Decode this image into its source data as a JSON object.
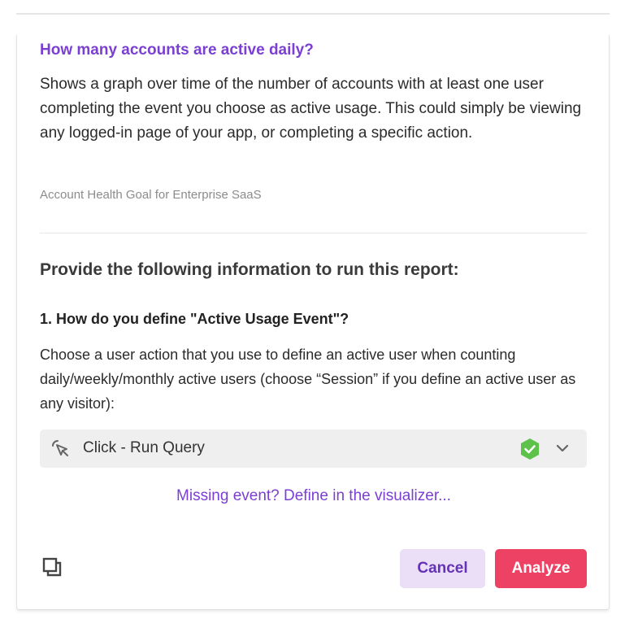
{
  "report": {
    "title": "How many accounts are active daily?",
    "description": "Shows a graph over time of the number of accounts with at least one user completing the event you choose as active usage. This could simply be viewing any logged-in page of your app, or completing a specific action.",
    "meta": "Account Health Goal for Enterprise SaaS"
  },
  "form": {
    "heading": "Provide the following information to run this report:",
    "question": {
      "label": "1. How do you define \"Active Usage Event\"?",
      "description": "Choose a user action that you use to define an active user when counting daily/weekly/monthly active users (choose “Session” if you define an active user as any visitor):",
      "selected_event": "Click - Run Query",
      "event_icon": "cursor-click-icon",
      "status_icon": "verified-shield-icon",
      "dropdown_icon": "chevron-down-icon"
    },
    "missing_link": "Missing event? Define in the visualizer..."
  },
  "footer": {
    "copy_icon": "copy-icon",
    "cancel_label": "Cancel",
    "analyze_label": "Analyze"
  },
  "colors": {
    "accent_purple": "#7b3fd1",
    "analyze_red": "#ee4264",
    "cancel_bg": "#ebdff8",
    "verified_green": "#5cc24a"
  }
}
